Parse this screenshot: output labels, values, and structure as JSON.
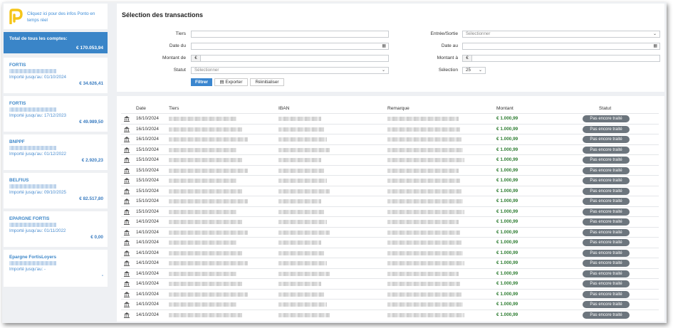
{
  "sidebar": {
    "logo_text": "Cliquez ici pour des infos Ponto en temps réel",
    "total_label": "Total de tous les comptes:",
    "total_value": "€ 170.053,94",
    "accounts": [
      {
        "name": "FORTIS",
        "imported": "Importé jusqu'au: 01/10/2024",
        "balance": "€ 34.626,41"
      },
      {
        "name": "FORTIS",
        "imported": "Importé jusqu'au: 17/12/2023",
        "balance": "€ 49.989,50"
      },
      {
        "name": "BNPPF",
        "imported": "Importé jusqu'au: 01/12/2022",
        "balance": "€ 2.920,23"
      },
      {
        "name": "BELFIUS",
        "imported": "Importé jusqu'au: 09/10/2025",
        "balance": "€ 82.517,80"
      },
      {
        "name": "EPARGNE FORTIS",
        "imported": "Importé jusqu'au: 01/11/2022",
        "balance": "€ 0,00"
      },
      {
        "name": "Epargne FortisLoyers",
        "imported": "Importé jusqu'au: -",
        "balance": "-"
      }
    ]
  },
  "filters": {
    "title": "Sélection des transactions",
    "tiers_label": "Tiers",
    "date_du_label": "Date du",
    "montant_de_label": "Montant de",
    "statut_label": "Statut",
    "statut_placeholder": "Sélectionner",
    "entree_sortie_label": "Entrée/Sortie",
    "entree_sortie_placeholder": "Sélectionner",
    "date_au_label": "Date au",
    "montant_a_label": "Montant à",
    "selection_label": "Sélection",
    "selection_value": "25",
    "euro_symbol": "€",
    "filter_button": "Filtrer",
    "export_button": "Exporter",
    "reset_button": "Réinitialiser"
  },
  "table": {
    "columns": {
      "date": "Date",
      "tiers": "Tiers",
      "iban": "IBAN",
      "remarque": "Remarque",
      "montant": "Montant",
      "statut": "Statut"
    },
    "rows": [
      {
        "date": "16/10/2024",
        "amount": "€ 1.000,99",
        "status": "Pas encore traité"
      },
      {
        "date": "16/10/2024",
        "amount": "€ 1.000,99",
        "status": "Pas encore traité"
      },
      {
        "date": "16/10/2024",
        "amount": "€ 1.000,99",
        "status": "Pas encore traité"
      },
      {
        "date": "15/10/2024",
        "amount": "€ 1.000,99",
        "status": "Pas encore traité"
      },
      {
        "date": "15/10/2024",
        "amount": "€ 1.000,99",
        "status": "Pas encore traité"
      },
      {
        "date": "15/10/2024",
        "amount": "€ 1.000,99",
        "status": "Pas encore traité"
      },
      {
        "date": "15/10/2024",
        "amount": "€ 1.000,99",
        "status": "Pas encore traité"
      },
      {
        "date": "15/10/2024",
        "amount": "€ 1.000,99",
        "status": "Pas encore traité"
      },
      {
        "date": "15/10/2024",
        "amount": "€ 1.000,99",
        "status": "Pas encore traité"
      },
      {
        "date": "15/10/2024",
        "amount": "€ 1.000,99",
        "status": "Pas encore traité"
      },
      {
        "date": "14/10/2024",
        "amount": "€ 1.000,99",
        "status": "Pas encore traité"
      },
      {
        "date": "14/10/2024",
        "amount": "€ 1.000,99",
        "status": "Pas encore traité"
      },
      {
        "date": "14/10/2024",
        "amount": "€ 1.000,99",
        "status": "Pas encore traité"
      },
      {
        "date": "14/10/2024",
        "amount": "€ 1.000,99",
        "status": "Pas encore traité"
      },
      {
        "date": "14/10/2024",
        "amount": "€ 1.000,99",
        "status": "Pas encore traité"
      },
      {
        "date": "14/10/2024",
        "amount": "€ 1.000,99",
        "status": "Pas encore traité"
      },
      {
        "date": "14/10/2024",
        "amount": "€ 1.000,99",
        "status": "Pas encore traité"
      },
      {
        "date": "14/10/2024",
        "amount": "€ 1.000,99",
        "status": "Pas encore traité"
      },
      {
        "date": "14/10/2024",
        "amount": "€ 1.000,99",
        "status": "Pas encore traité"
      },
      {
        "date": "14/10/2024",
        "amount": "€ 1.000,99",
        "status": "Pas encore traité"
      }
    ]
  },
  "colors": {
    "accent": "#3a86cf",
    "amount_green": "#2e7d32",
    "status_badge": "#6c757d",
    "logo_yellow": "#f5c518"
  },
  "icons": {
    "logo": "ponto-logo-icon",
    "bank": "bank-icon",
    "calendar": "calendar-icon",
    "chevron": "chevron-down-icon",
    "export": "export-icon"
  }
}
